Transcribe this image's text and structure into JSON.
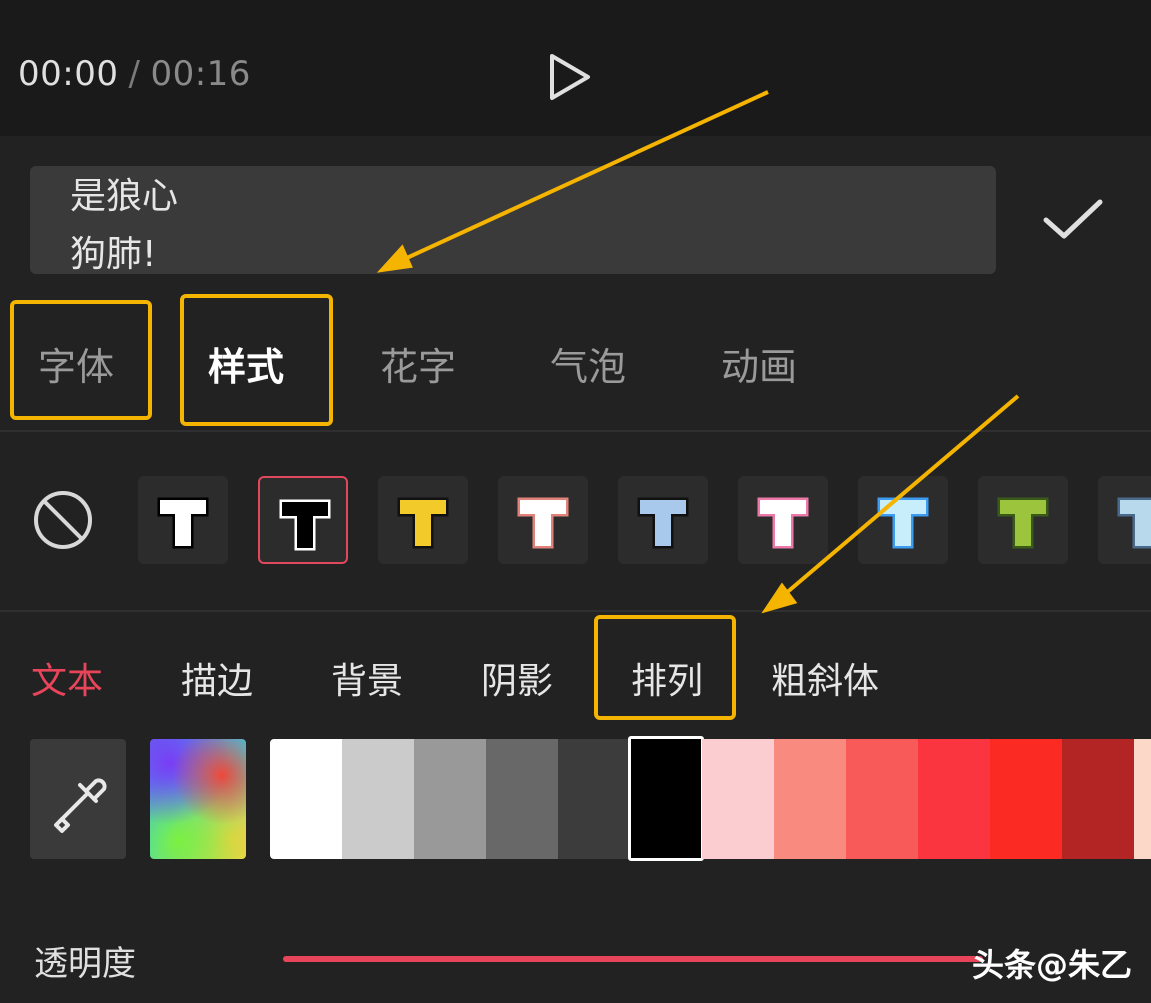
{
  "player": {
    "current_time": "00:00",
    "separator": "/",
    "total_time": "00:16"
  },
  "editor": {
    "text_line_1": "是狼心",
    "text_line_2": "狗肺!"
  },
  "tabs": [
    {
      "label": "字体"
    },
    {
      "label": "样式"
    },
    {
      "label": "花字"
    },
    {
      "label": "气泡"
    },
    {
      "label": "动画"
    }
  ],
  "active_tab": "样式",
  "presets": {
    "none_icon": "no-style-icon",
    "items": [
      {
        "fill": "#ffffff",
        "stroke": "#000000"
      },
      {
        "fill": "#000000",
        "stroke": "#ffffff"
      },
      {
        "fill": "#f2cb2a",
        "stroke": "#111111"
      },
      {
        "fill": "#ffffff",
        "stroke": "#e0827a"
      },
      {
        "fill": "#a8c8ec",
        "stroke": "#111111"
      },
      {
        "fill": "#ffffff",
        "stroke": "#ec79a8"
      },
      {
        "fill": "#c8eefc",
        "stroke": "#3c9cf0"
      },
      {
        "fill": "#9cc43c",
        "stroke": "#3a5a1a"
      },
      {
        "fill": "#b8d8ec",
        "stroke": "#4a6a8c"
      }
    ]
  },
  "sub_tabs": [
    {
      "label": "文本"
    },
    {
      "label": "描边"
    },
    {
      "label": "背景"
    },
    {
      "label": "阴影"
    },
    {
      "label": "排列"
    },
    {
      "label": "粗斜体"
    }
  ],
  "active_sub_tab": "文本",
  "colors": {
    "picker_icon": "eyedropper-icon",
    "swatches": [
      "#ffffff",
      "#cbcbcb",
      "#999999",
      "#686868",
      "#3c3c3c",
      "#000000",
      "#fccdd0",
      "#f88a80",
      "#f85a5a",
      "#fa3540",
      "#fb2a22",
      "#b32525",
      "#fcd8c8"
    ],
    "selected": "#000000"
  },
  "opacity": {
    "label": "透明度"
  },
  "watermark": "头条@朱乙",
  "accent_color": "#e8455a",
  "highlight_color": "#f5b400"
}
